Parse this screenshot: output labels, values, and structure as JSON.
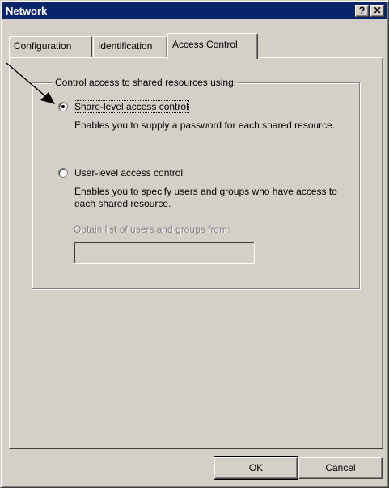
{
  "window": {
    "title": "Network",
    "help_button": "?",
    "close_button": "✕"
  },
  "tabs": [
    {
      "label": "Configuration",
      "active": false
    },
    {
      "label": "Identification",
      "active": false
    },
    {
      "label": "Access Control",
      "active": true
    }
  ],
  "access_control": {
    "group_label": "Control access to shared resources using:",
    "options": [
      {
        "label": "Share-level access control",
        "selected": true,
        "description": "Enables you to supply a password for each shared resource."
      },
      {
        "label": "User-level access control",
        "selected": false,
        "description": "Enables you to specify users and groups who have access to each shared resource."
      }
    ],
    "obtain_list_label": "Obtain list of users and groups from:",
    "obtain_list_value": ""
  },
  "buttons": {
    "ok": "OK",
    "cancel": "Cancel"
  },
  "colors": {
    "title_bar": "#0a246a",
    "face": "#d4d0c8"
  }
}
